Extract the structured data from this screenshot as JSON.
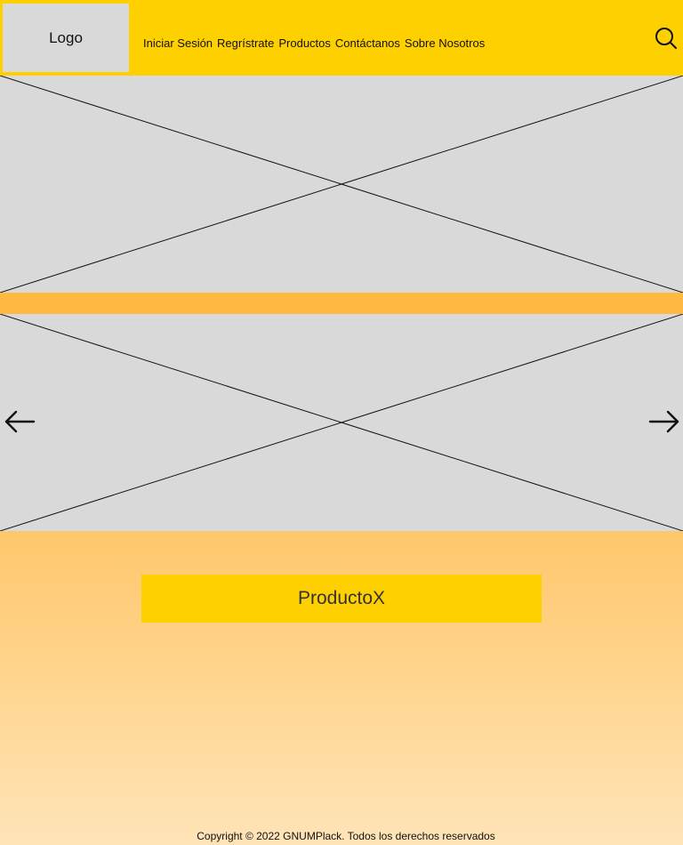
{
  "header": {
    "logo_text": "Logo",
    "nav": [
      "Iniciar Sesión",
      "Regrístrate",
      "Productos",
      "Contáctanos",
      "Sobre Nosotros"
    ],
    "search_icon": "search-icon"
  },
  "carousel": {
    "prev_icon": "arrow-left-icon",
    "next_icon": "arrow-right-icon"
  },
  "main": {
    "product_label": "ProductoX"
  },
  "footer": {
    "copyright": "Copyright © 2022 GNUMPlack. Todos los derechos reservados"
  },
  "colors": {
    "header_bg": "#FFD000",
    "placeholder_bg": "#D9D9D9",
    "band": "#FFB940",
    "gradient_top": "#FFC76B",
    "gradient_bottom": "#FFE4B8",
    "product_bg": "#FFD000"
  }
}
